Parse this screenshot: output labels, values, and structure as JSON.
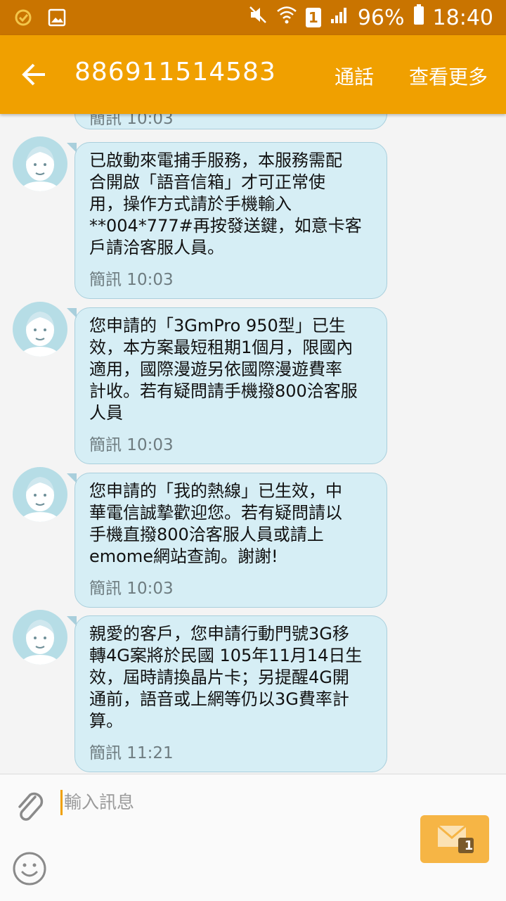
{
  "status_bar": {
    "battery": "96%",
    "time": "18:40",
    "sim_slot": "1",
    "icons": [
      "notification-icon",
      "gallery-icon",
      "mute-icon",
      "wifi-icon",
      "sim-icon",
      "signal-icon",
      "battery-icon"
    ]
  },
  "app_bar": {
    "title": "886911514583",
    "call_label": "通話",
    "more_label": "查看更多",
    "back_icon": "back-arrow-icon"
  },
  "messages": [
    {
      "text": "簡訊 10:03",
      "meta": ""
    },
    {
      "text": "已啟動來電捕手服務，本服務需配\n合開啟「語音信箱」才可正常使\n用，操作方式請於手機輸入\n**004*777#再按發送鍵，如意卡客\n戶請洽客服人員。",
      "meta": "簡訊 10:03"
    },
    {
      "text": "您申請的「3GmPro 950型」已生\n效，本方案最短租期1個月，限國內\n適用，國際漫遊另依國際漫遊費率\n計收。若有疑問請手機撥800洽客服\n人員",
      "meta": "簡訊 10:03"
    },
    {
      "text": "您申請的「我的熱線」已生效，中\n華電信誠摯歡迎您。若有疑問請以\n手機直撥800洽客服人員或請上\nemome網站查詢。謝謝!",
      "meta": "簡訊 10:03"
    },
    {
      "text": "親愛的客戶，您申請行動門號3G移\n轉4G案將於民國 105年11月14日生\n效，屆時請換晶片卡；另提醒4G開\n通前，語音或上網等仍以3G費率計\n算。",
      "meta": "簡訊 11:21"
    }
  ],
  "composer": {
    "placeholder": "輸入訊息",
    "send_sim_badge": "1"
  },
  "colors": {
    "status_bar": "#c97400",
    "app_bar": "#f0a000",
    "bubble": "#d6eef5",
    "send_button": "#f6b545"
  }
}
